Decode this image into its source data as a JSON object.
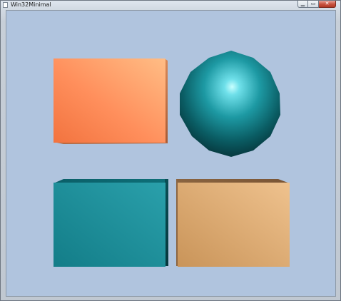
{
  "window": {
    "title": "Win32Minimal",
    "buttons": {
      "minimize_icon": "minimize-icon",
      "maximize_icon": "maximize-icon",
      "close_icon": "close-icon",
      "minimize_glyph": "▁",
      "maximize_glyph": "▭",
      "close_glyph": "✕"
    }
  },
  "scene": {
    "background_color": "#b0c4de",
    "objects": [
      {
        "name": "orange-box",
        "shape": "box",
        "color": "#ff8f5a"
      },
      {
        "name": "teal-sphere",
        "shape": "sphere",
        "color": "#0f7f88"
      },
      {
        "name": "teal-box",
        "shape": "box",
        "color": "#20909c"
      },
      {
        "name": "tan-box",
        "shape": "box",
        "color": "#d8a76f"
      }
    ]
  }
}
